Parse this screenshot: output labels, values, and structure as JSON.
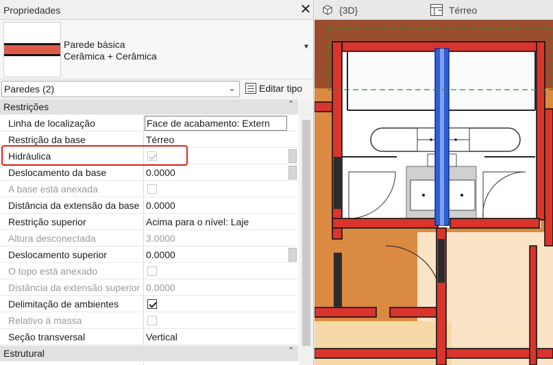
{
  "panel": {
    "title": "Propriedades",
    "close_glyph": "✕",
    "type": {
      "name": "Parede básica",
      "subname": "Cerâmica + Cerâmica",
      "arrow": "▼"
    },
    "selector": {
      "value": "Paredes (2)",
      "chevron": "⌄"
    },
    "edit_type": "Editar tipo",
    "groups": [
      {
        "label": "Restrições",
        "collapse_glyph": "⌃"
      },
      {
        "label": "Estrutural",
        "collapse_glyph": "⌃"
      }
    ],
    "rows": [
      {
        "name": "Linha de localização",
        "value": "Face de acabamento: Extern"
      },
      {
        "name": "Restrição da base",
        "value": "Térreo"
      },
      {
        "name": "Hidráulica",
        "value": ""
      },
      {
        "name": "Deslocamento da base",
        "value": "0.0000"
      },
      {
        "name": "A base está anexada",
        "value": ""
      },
      {
        "name": "Distância da extensão da base",
        "value": "0.0000"
      },
      {
        "name": "Restrição superior",
        "value": "Acima para o nível: Laje"
      },
      {
        "name": "Altura desconectada",
        "value": "3.0000"
      },
      {
        "name": "Deslocamento superior",
        "value": "0.0000"
      },
      {
        "name": "O topo está anexado",
        "value": ""
      },
      {
        "name": "Distância da extensão superior",
        "value": "0.0000"
      },
      {
        "name": "Delimitação de ambientes",
        "value": ""
      },
      {
        "name": "Relativo à massa",
        "value": ""
      },
      {
        "name": "Seção transversal",
        "value": "Vertical"
      }
    ]
  },
  "view": {
    "tabs": [
      {
        "label": "{3D}",
        "icon": "cube-icon"
      },
      {
        "label": "Térreo",
        "icon": "floor-plan-icon"
      }
    ]
  },
  "colors": {
    "wall_red": "#d9352c",
    "floor_orange": "#db8a42",
    "floor_beige": "#fbe3c6",
    "pipe_blue": "#2f5fd0",
    "highlight_red": "#e0211c"
  }
}
